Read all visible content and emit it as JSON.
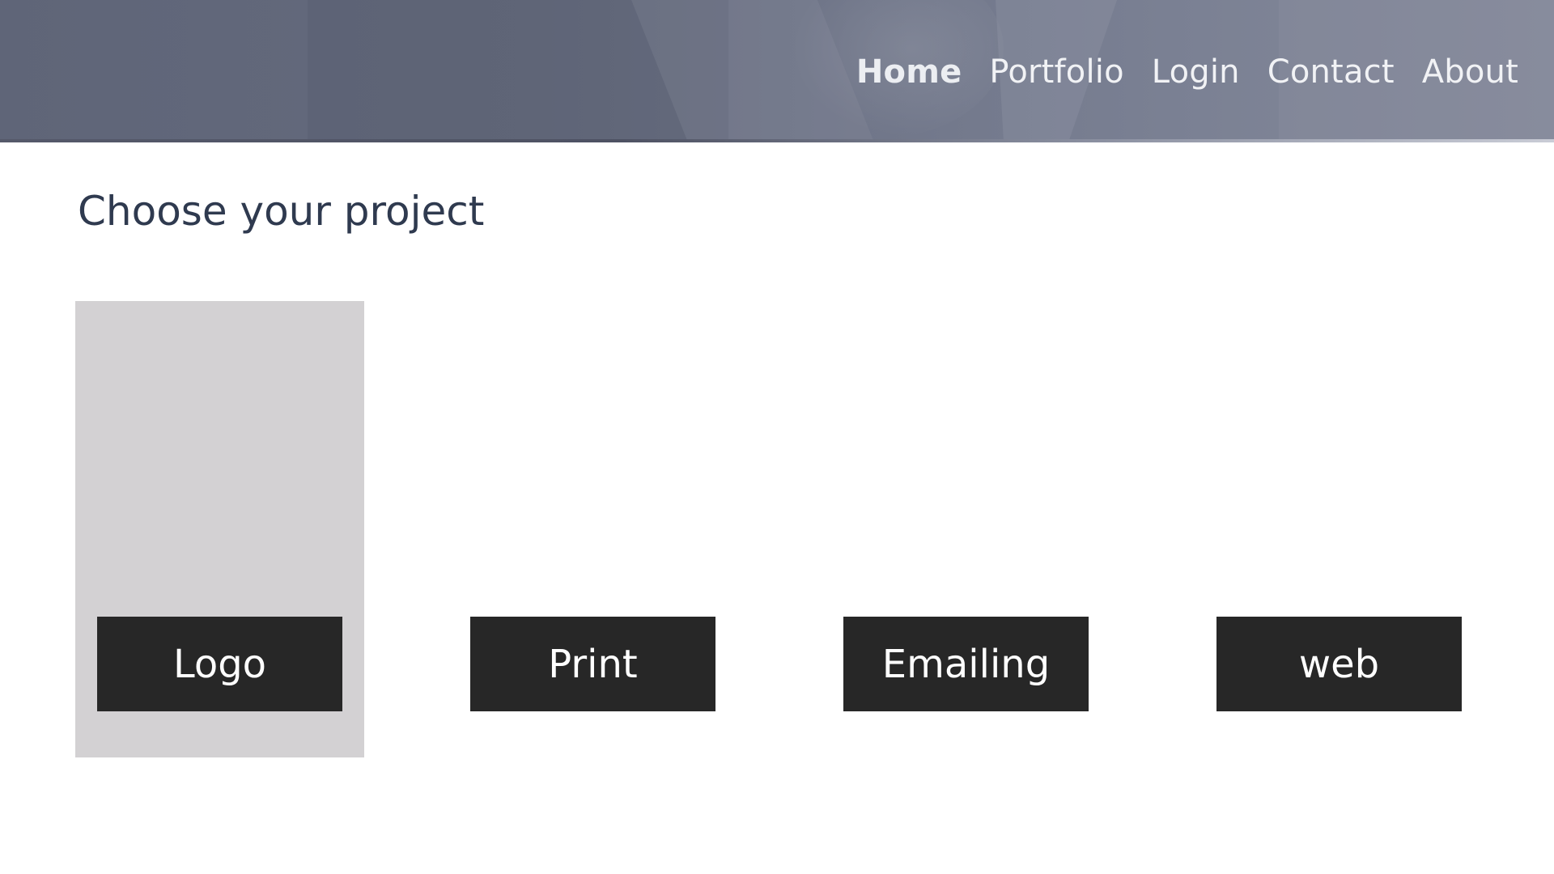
{
  "nav": {
    "items": [
      {
        "label": "Home",
        "active": true
      },
      {
        "label": "Portfolio"
      },
      {
        "label": "Login"
      },
      {
        "label": "Contact"
      },
      {
        "label": "About"
      }
    ]
  },
  "main": {
    "title": "Choose your project",
    "projects": [
      {
        "label": "Logo",
        "highlighted": true
      },
      {
        "label": "Print"
      },
      {
        "label": "Emailing"
      },
      {
        "label": "web"
      }
    ]
  },
  "colors": {
    "header_overlay": "#646a7d",
    "title_text": "#2f3a4f",
    "button_bg": "#272727",
    "button_text": "#ffffff",
    "highlight_card": "#d3d1d3"
  }
}
